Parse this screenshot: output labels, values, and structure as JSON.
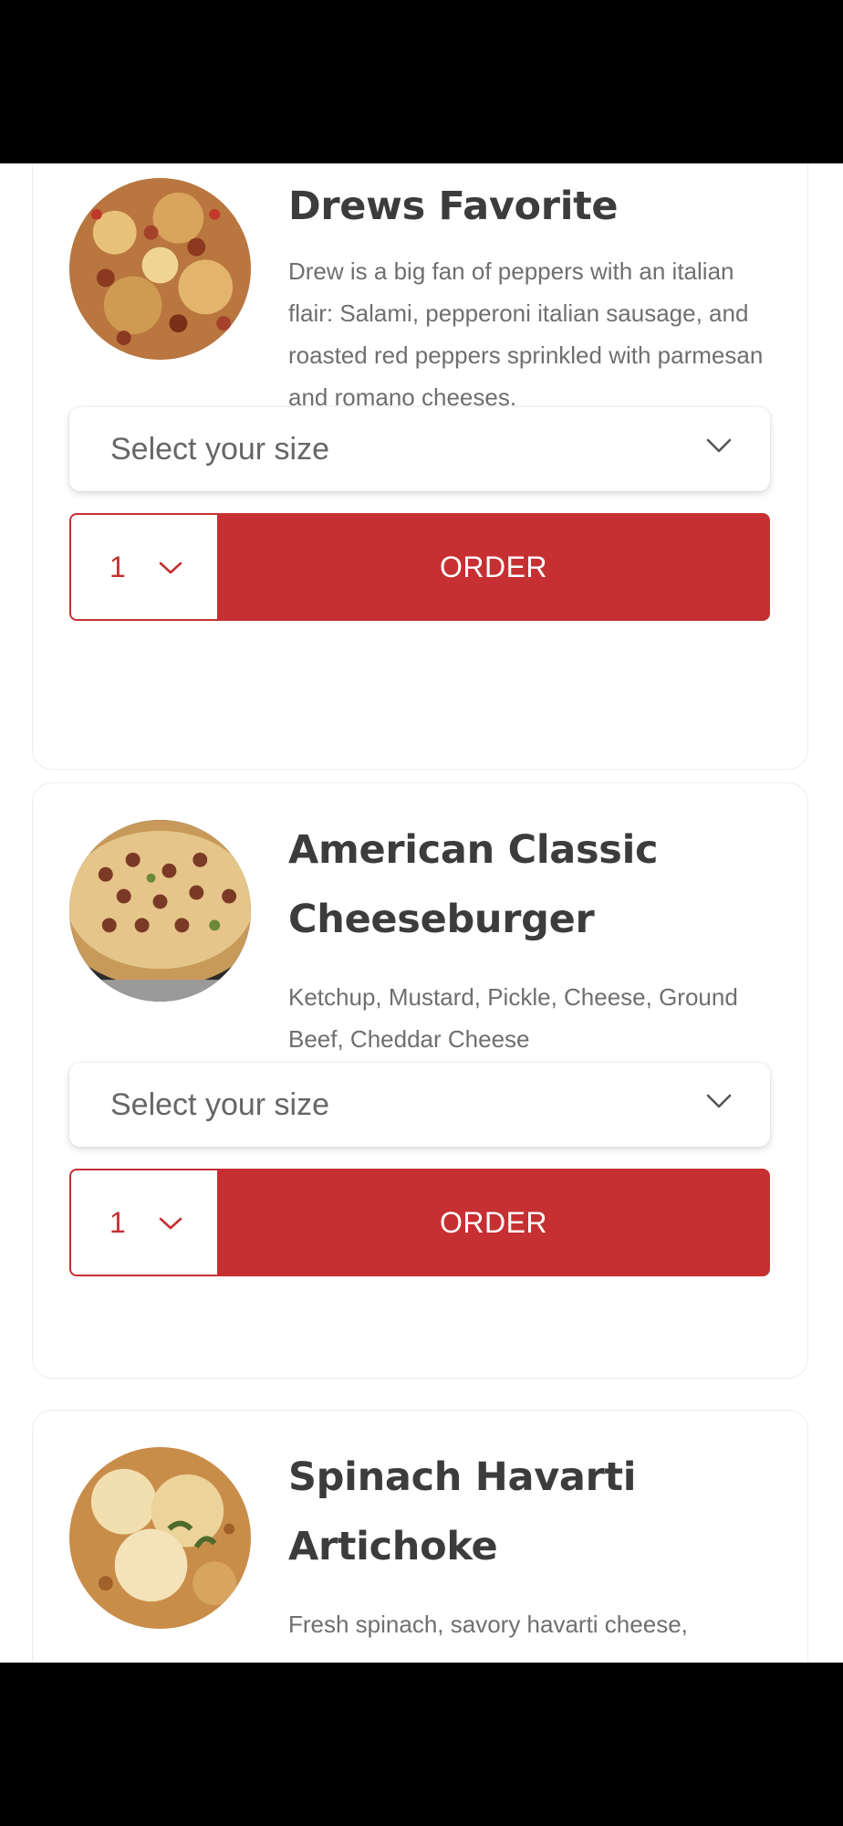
{
  "menu_items": [
    {
      "title": "Drews Favorite",
      "description": "Drew is a big fan of peppers with an italian flair: Salami, pepperoni italian sausage, and roasted red peppers sprinkled with parmesan and romano cheeses.",
      "size_select": "Select your size",
      "quantity": "1",
      "order_label": "ORDER"
    },
    {
      "title": "American Classic Cheeseburger",
      "description": "Ketchup, Mustard, Pickle, Cheese, Ground Beef, Cheddar Cheese",
      "size_select": "Select your size",
      "quantity": "1",
      "order_label": "ORDER"
    },
    {
      "title": "Spinach Havarti Artichoke",
      "description": "Fresh spinach, savory havarti cheese,"
    }
  ],
  "icons": {
    "dropdown": "chevron-down-icon",
    "image": "pizza-photo"
  },
  "colors": {
    "accent": "#c63033",
    "title": "#3c3c3c",
    "text": "#6f6f6f",
    "background": "#ffffff"
  }
}
